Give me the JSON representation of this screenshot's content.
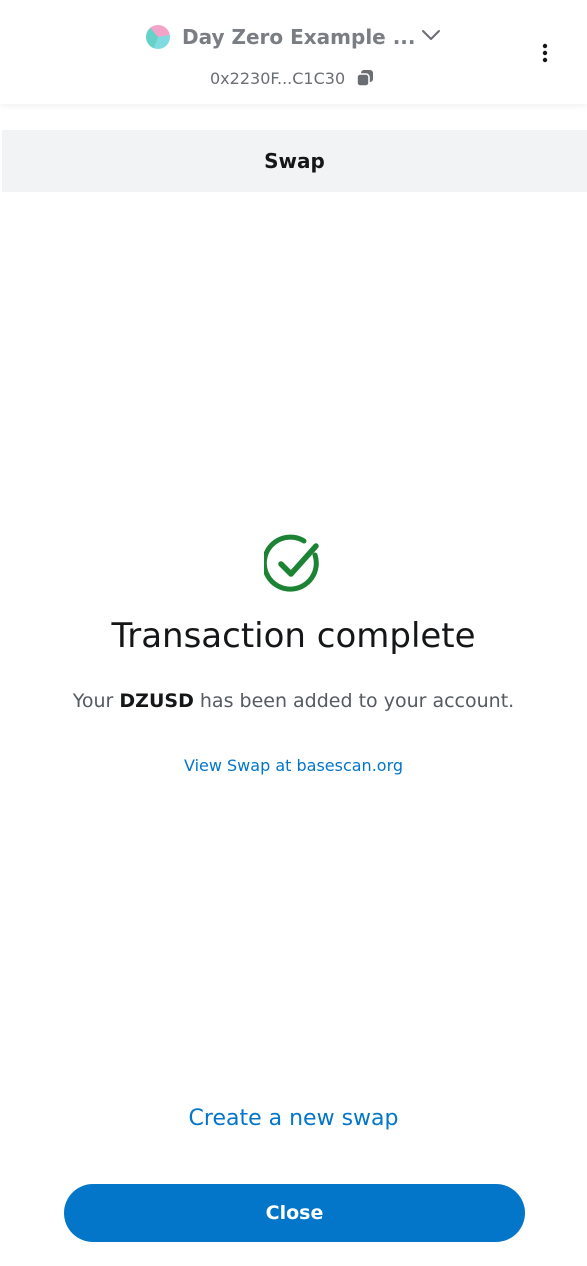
{
  "header": {
    "account_name": "Day Zero Example ...",
    "account_address": "0x2230F...C1C30",
    "avatar_icon": "account-avatar-icon",
    "dropdown_icon": "chevron-down-icon",
    "copy_icon": "copy-icon",
    "menu_icon": "kebab-menu-icon"
  },
  "subheader": {
    "title": "Swap"
  },
  "status": {
    "icon": "check-circle-icon",
    "icon_color": "#1c8234",
    "title": "Transaction complete",
    "message_prefix": "Your",
    "token": "DZUSD",
    "message_suffix": "has been added to your account.",
    "explorer_link": "View Swap at basescan.org"
  },
  "actions": {
    "new_swap_label": "Create a new swap",
    "close_label": "Close"
  },
  "colors": {
    "accent": "#0376c9",
    "success": "#1c8234",
    "text_primary": "#141618",
    "text_muted": "#6a6d72"
  }
}
